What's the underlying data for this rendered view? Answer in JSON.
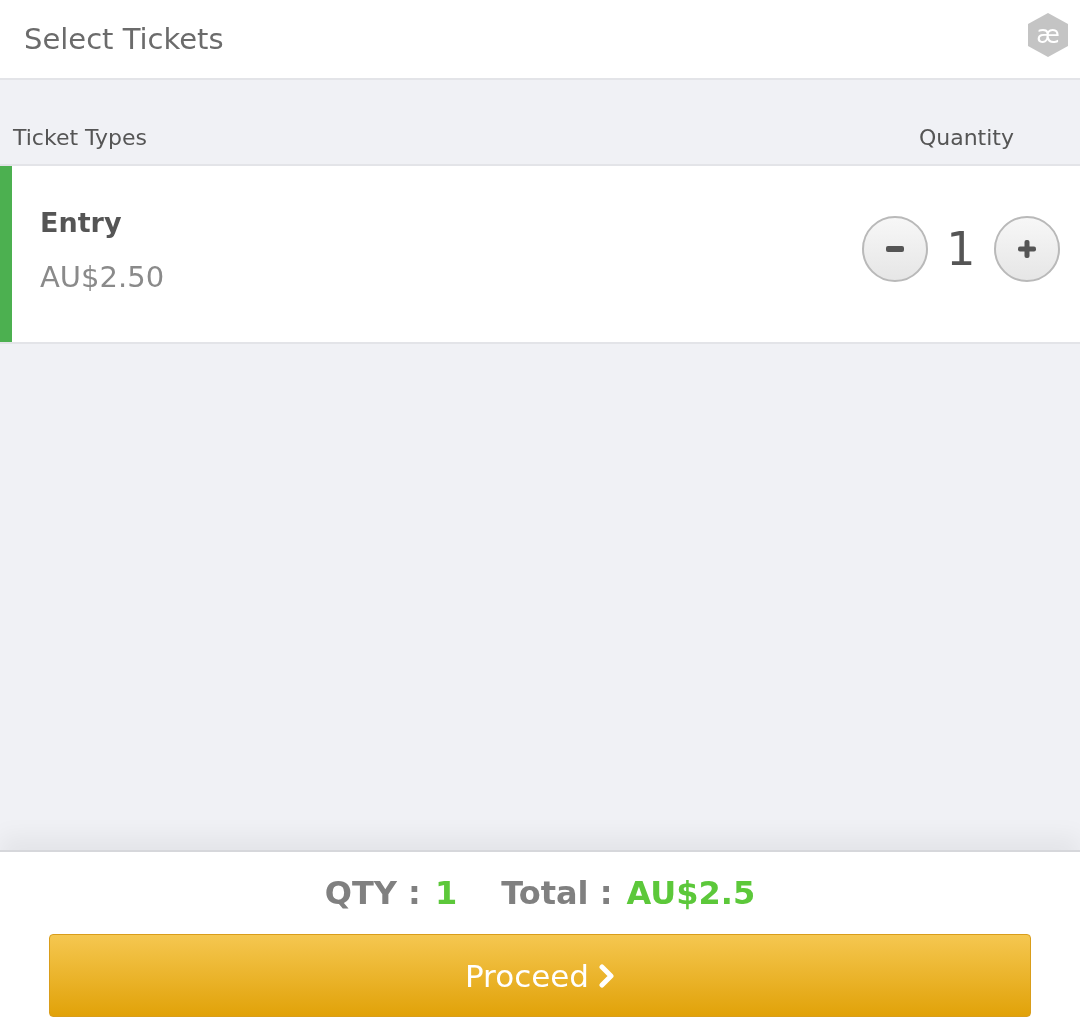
{
  "header": {
    "title": "Select Tickets",
    "logo": "æ"
  },
  "columns": {
    "ticket_types": "Ticket Types",
    "quantity": "Quantity"
  },
  "tickets": [
    {
      "name": "Entry",
      "price": "AU$2.50",
      "quantity": "1",
      "selected": true
    }
  ],
  "summary": {
    "qty_label": "QTY :",
    "qty": "1",
    "total_label": "Total :",
    "total": "AU$2.5"
  },
  "proceed_button": {
    "label": "Proceed"
  }
}
